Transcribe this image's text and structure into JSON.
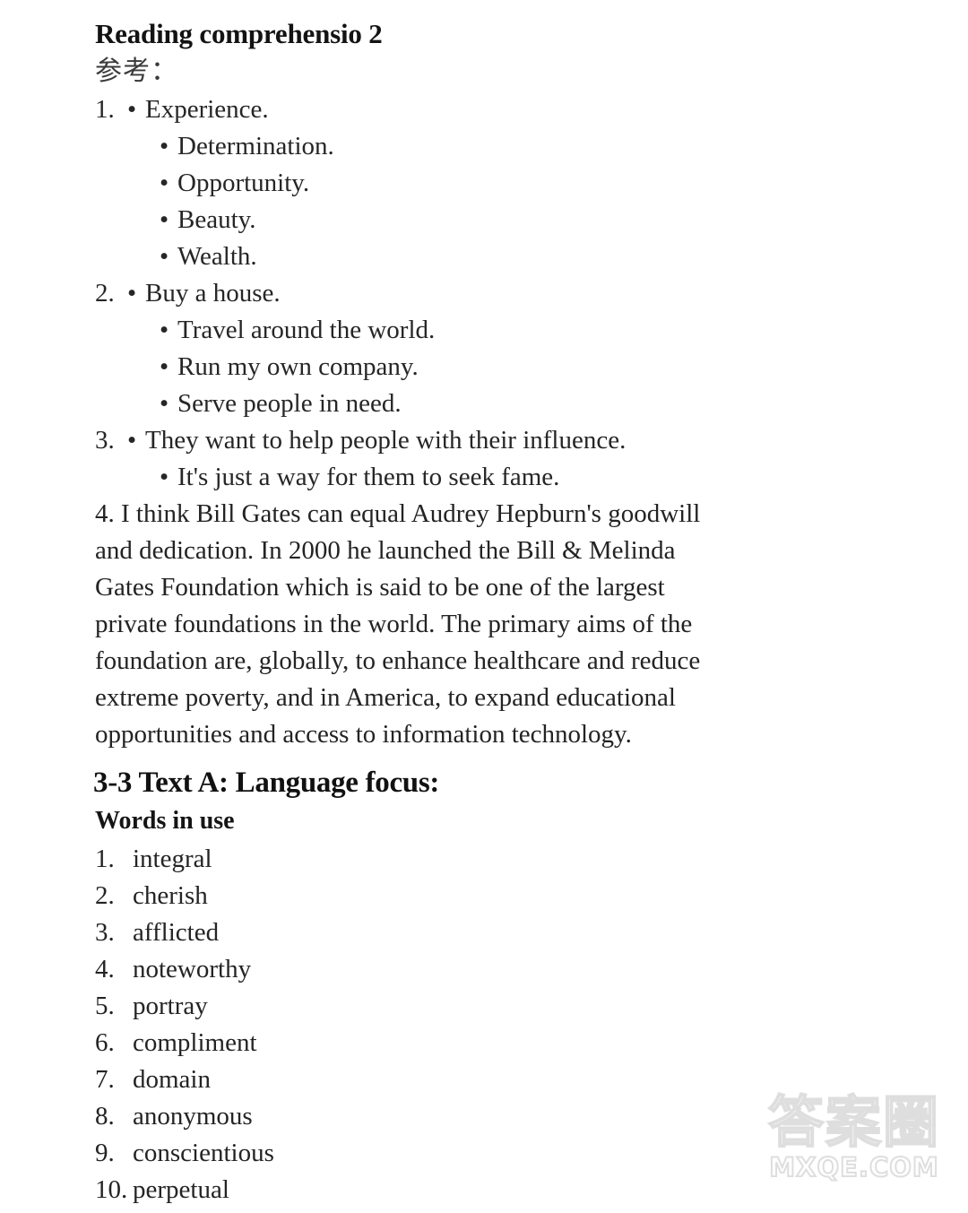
{
  "document": {
    "title": "Reading comprehensio 2",
    "reference_label": "参考：",
    "section_heading": "3-3 Text A: Language focus:",
    "sub_heading": "Words in use"
  },
  "answers": [
    {
      "number": "1.",
      "bullet": "•",
      "lead": "Experience.",
      "subs": [
        "Determination.",
        "Opportunity.",
        "Beauty.",
        "Wealth."
      ]
    },
    {
      "number": "2.",
      "bullet": "•",
      "lead": "Buy a house.",
      "subs": [
        "Travel around the world.",
        "Run my own company.",
        "Serve people in need."
      ]
    },
    {
      "number": "3.",
      "bullet": "•",
      "lead": "They want to help people with their influence.",
      "subs": [
        "It's just a way for them to seek fame."
      ]
    }
  ],
  "paragraph": {
    "number": "4.",
    "lines": [
      "4. I think Bill Gates can equal Audrey Hepburn's goodwill",
      "and dedication. In 2000 he launched the Bill & Melinda",
      "Gates Foundation which is said to be one of the largest",
      "private foundations in the world. The primary aims of the",
      "foundation are, globally, to enhance healthcare and reduce",
      "extreme poverty, and in America, to expand educational",
      "opportunities and access to information technology."
    ],
    "full_text": "4. I think Bill Gates can equal Audrey Hepburn's goodwill and dedication. In 2000 he launched the Bill & Melinda Gates Foundation which is said to be one of the largest private foundations in the world. The primary aims of the foundation are, globally, to enhance healthcare and reduce extreme poverty, and in America, to expand educational opportunities and access to information technology."
  },
  "words_in_use": [
    {
      "number": "1.",
      "word": "integral"
    },
    {
      "number": "2.",
      "word": "cherish"
    },
    {
      "number": "3.",
      "word": "afflicted"
    },
    {
      "number": "4.",
      "word": "noteworthy"
    },
    {
      "number": "5.",
      "word": "portray"
    },
    {
      "number": "6.",
      "word": "compliment"
    },
    {
      "number": "7.",
      "word": "domain"
    },
    {
      "number": "8.",
      "word": "anonymous"
    },
    {
      "number": "9.",
      "word": "conscientious"
    },
    {
      "number": "10.",
      "word": "perpetual"
    }
  ],
  "watermark": {
    "chinese": "答案圈",
    "site": "MXQE.COM",
    "color": "#dedede"
  }
}
